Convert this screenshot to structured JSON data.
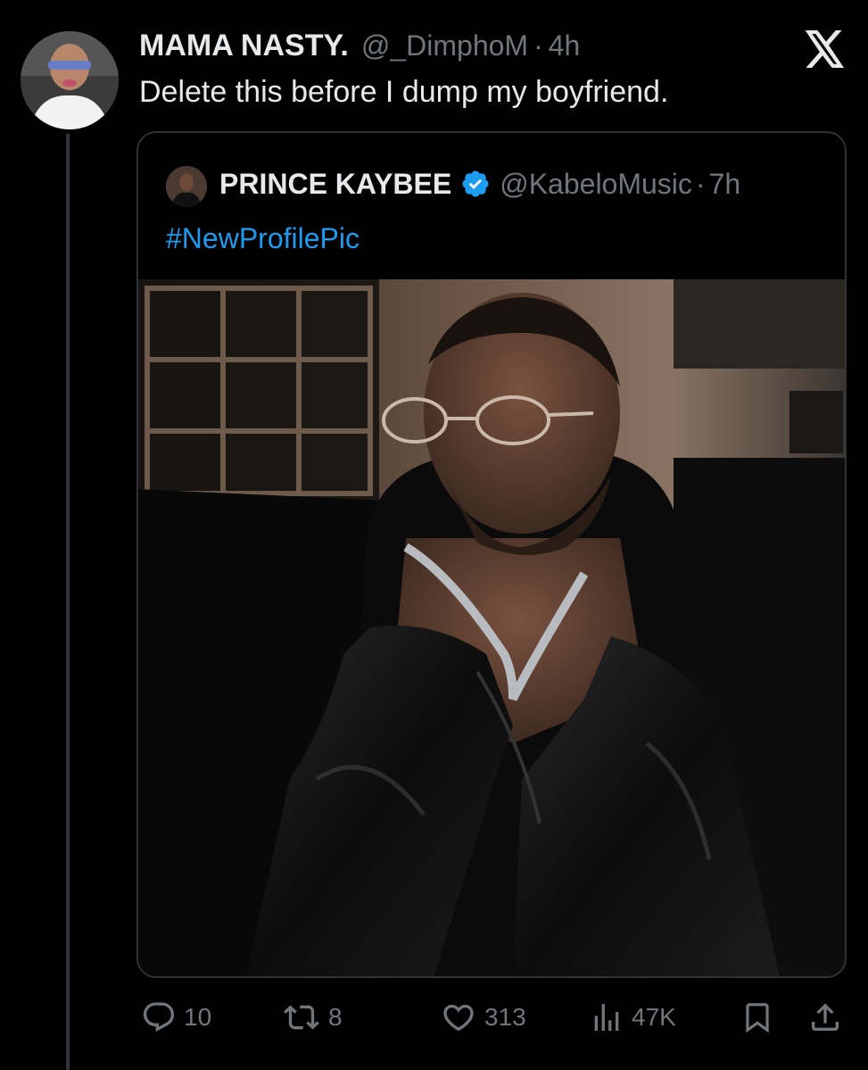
{
  "tweet": {
    "author_name": "MAMA NASTY.",
    "author_handle": "@_DimphoM",
    "separator": "·",
    "time": "4h",
    "text": "Delete this before I dump my boyfriend."
  },
  "quoted_tweet": {
    "author_name": "PRINCE KAYBEE",
    "author_handle": "@KabeloMusic",
    "separator": "·",
    "time": "7h",
    "verified": true,
    "text": "#NewProfilePic"
  },
  "actions": {
    "replies": "10",
    "reposts": "8",
    "likes": "313",
    "views": "47K"
  },
  "icons": [
    "x-logo-icon",
    "verified-badge-icon",
    "reply-icon",
    "repost-icon",
    "like-icon",
    "views-icon",
    "bookmark-icon",
    "share-icon"
  ],
  "colors": {
    "background": "#000000",
    "text": "#e7e9ea",
    "secondary": "#71767b",
    "link": "#1d9bf0",
    "verified": "#1d9bf0"
  }
}
